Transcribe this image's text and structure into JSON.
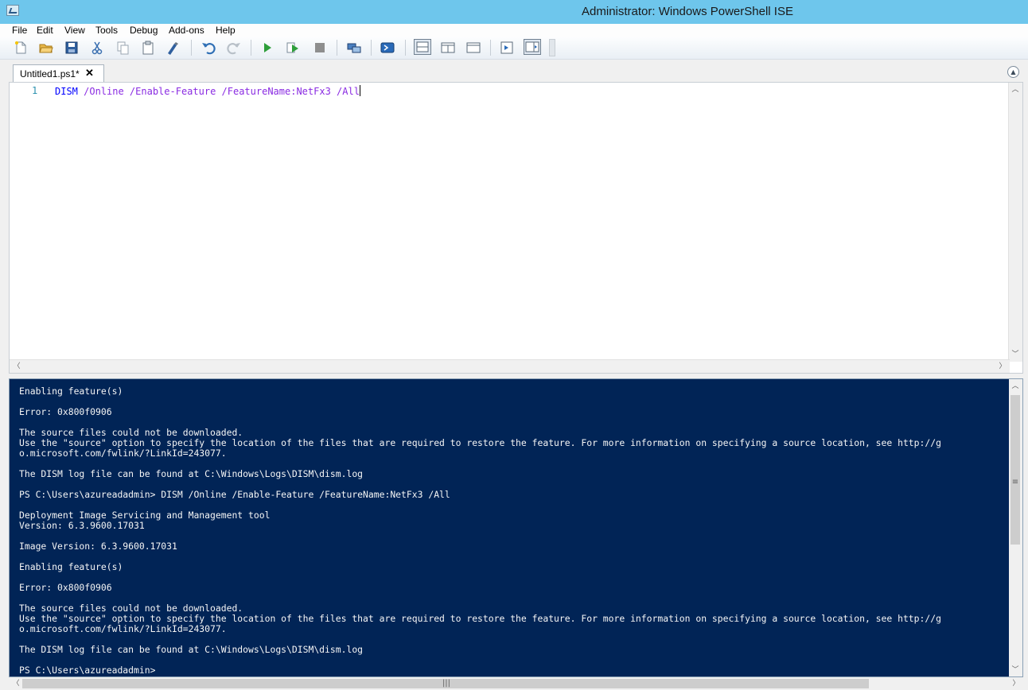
{
  "window": {
    "title": "Administrator: Windows PowerShell ISE"
  },
  "menu": [
    "File",
    "Edit",
    "View",
    "Tools",
    "Debug",
    "Add-ons",
    "Help"
  ],
  "toolbar": {
    "icons": [
      "new-file-icon",
      "open-folder-icon",
      "save-icon",
      "cut-icon",
      "copy-icon",
      "paste-icon",
      "clear-console-icon",
      "undo-icon",
      "redo-icon",
      "run-script-icon",
      "run-selection-icon",
      "stop-icon",
      "new-remote-tab-icon",
      "start-powershell-icon",
      "show-script-top-icon",
      "show-script-right-icon",
      "show-script-max-icon",
      "show-commands-icon",
      "show-addon-icon"
    ]
  },
  "tab": {
    "label": "Untitled1.ps1*",
    "close": "✕"
  },
  "editor": {
    "line_number": "1",
    "command": "DISM",
    "arguments": " /Online /Enable-Feature /FeatureName:NetFx3 /All"
  },
  "console": {
    "lines": [
      "Enabling feature(s)",
      "",
      "Error: 0x800f0906",
      "",
      "The source files could not be downloaded.",
      "Use the \"source\" option to specify the location of the files that are required to restore the feature. For more information on specifying a source location, see http://g",
      "o.microsoft.com/fwlink/?LinkId=243077.",
      "",
      "The DISM log file can be found at C:\\Windows\\Logs\\DISM\\dism.log",
      "",
      "PS C:\\Users\\azureadadmin> DISM /Online /Enable-Feature /FeatureName:NetFx3 /All",
      "",
      "Deployment Image Servicing and Management tool",
      "Version: 6.3.9600.17031",
      "",
      "Image Version: 6.3.9600.17031",
      "",
      "Enabling feature(s)",
      "",
      "Error: 0x800f0906",
      "",
      "The source files could not be downloaded.",
      "Use the \"source\" option to specify the location of the files that are required to restore the feature. For more information on specifying a source location, see http://g",
      "o.microsoft.com/fwlink/?LinkId=243077.",
      "",
      "The DISM log file can be found at C:\\Windows\\Logs\\DISM\\dism.log",
      "",
      "PS C:\\Users\\azureadadmin>"
    ]
  },
  "colors": {
    "titlebar": "#6ec6ec",
    "console_bg": "#012456",
    "console_fg": "#f5f5f5",
    "command": "#0000ff",
    "argument": "#8a2be2"
  }
}
